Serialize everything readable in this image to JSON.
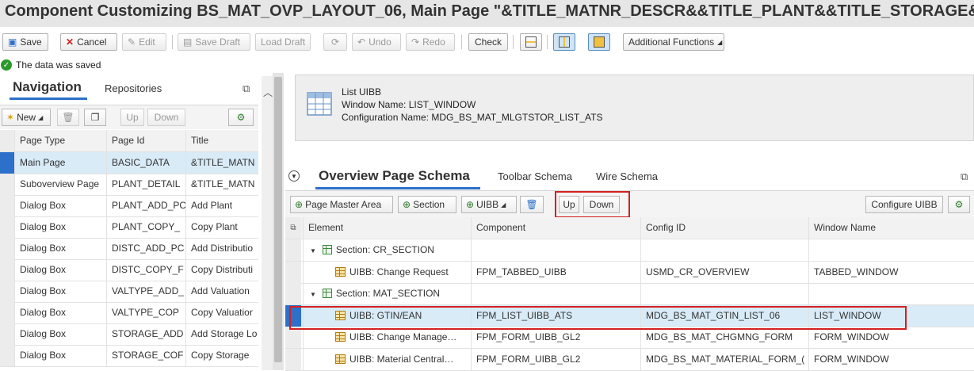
{
  "window": {
    "title": "Component Customizing BS_MAT_OVP_LAYOUT_06, Main Page \"&TITLE_MATNR_DESCR&&TITLE_PLANT&&TITLE_STORAGE&"
  },
  "toolbar": {
    "save": "Save",
    "cancel": "Cancel",
    "edit": "Edit",
    "save_draft": "Save Draft",
    "load_draft": "Load Draft",
    "undo": "Undo",
    "redo": "Redo",
    "check": "Check",
    "additional_functions": "Additional Functions"
  },
  "message": {
    "text": "The data was saved"
  },
  "navigation": {
    "title": "Navigation",
    "repositories_tab": "Repositories",
    "toolbar": {
      "new": "New",
      "up": "Up",
      "down": "Down"
    },
    "columns": [
      "Page Type",
      "Page Id",
      "Title"
    ],
    "rows": [
      {
        "type": "Main Page",
        "id": "BASIC_DATA",
        "title": "&TITLE_MATN"
      },
      {
        "type": "Suboverview Page",
        "id": "PLANT_DETAIL",
        "title": "&TITLE_MATN"
      },
      {
        "type": "Dialog Box",
        "id": "PLANT_ADD_PC",
        "title": "Add Plant"
      },
      {
        "type": "Dialog Box",
        "id": "PLANT_COPY_",
        "title": "Copy Plant"
      },
      {
        "type": "Dialog Box",
        "id": "DISTC_ADD_PC",
        "title": "Add Distributio"
      },
      {
        "type": "Dialog Box",
        "id": "DISTC_COPY_F",
        "title": "Copy Distributi"
      },
      {
        "type": "Dialog Box",
        "id": "VALTYPE_ADD_",
        "title": "Add Valuation"
      },
      {
        "type": "Dialog Box",
        "id": "VALTYPE_COP",
        "title": "Copy Valuatior"
      },
      {
        "type": "Dialog Box",
        "id": "STORAGE_ADD",
        "title": "Add Storage Lo"
      },
      {
        "type": "Dialog Box",
        "id": "STORAGE_COF",
        "title": "Copy Storage"
      }
    ],
    "selected_row": 0
  },
  "uibb_info": {
    "line1": "List UIBB",
    "line2": "Window Name: LIST_WINDOW",
    "line3": "Configuration Name: MDG_BS_MAT_MLGTSTOR_LIST_ATS"
  },
  "overview": {
    "title": "Overview Page Schema",
    "tab_toolbar": "Toolbar Schema",
    "tab_wire": "Wire Schema",
    "toolbar": {
      "page_master_area": "Page Master Area",
      "section": "Section",
      "uibb": "UIBB",
      "up": "Up",
      "down": "Down",
      "configure_uibb": "Configure UIBB"
    },
    "columns": [
      "Element",
      "Component",
      "Config ID",
      "Window Name"
    ],
    "rows": [
      {
        "kind": "section",
        "element": "Section: CR_SECTION",
        "component": "",
        "config": "",
        "window": ""
      },
      {
        "kind": "uibb",
        "element": "UIBB: Change Request",
        "component": "FPM_TABBED_UIBB",
        "config": "USMD_CR_OVERVIEW",
        "window": "TABBED_WINDOW"
      },
      {
        "kind": "section",
        "element": "Section: MAT_SECTION",
        "component": "",
        "config": "",
        "window": ""
      },
      {
        "kind": "uibb",
        "element": "UIBB: GTIN/EAN",
        "component": "FPM_LIST_UIBB_ATS",
        "config": "MDG_BS_MAT_GTIN_LIST_06",
        "window": "LIST_WINDOW"
      },
      {
        "kind": "uibb",
        "element": "UIBB: Change Manage…",
        "component": "FPM_FORM_UIBB_GL2",
        "config": "MDG_BS_MAT_CHGMNG_FORM",
        "window": "FORM_WINDOW"
      },
      {
        "kind": "uibb",
        "element": "UIBB: Material Central…",
        "component": "FPM_FORM_UIBB_GL2",
        "config": "MDG_BS_MAT_MATERIAL_FORM_(",
        "window": "FORM_WINDOW"
      }
    ],
    "selected_row": 3
  }
}
